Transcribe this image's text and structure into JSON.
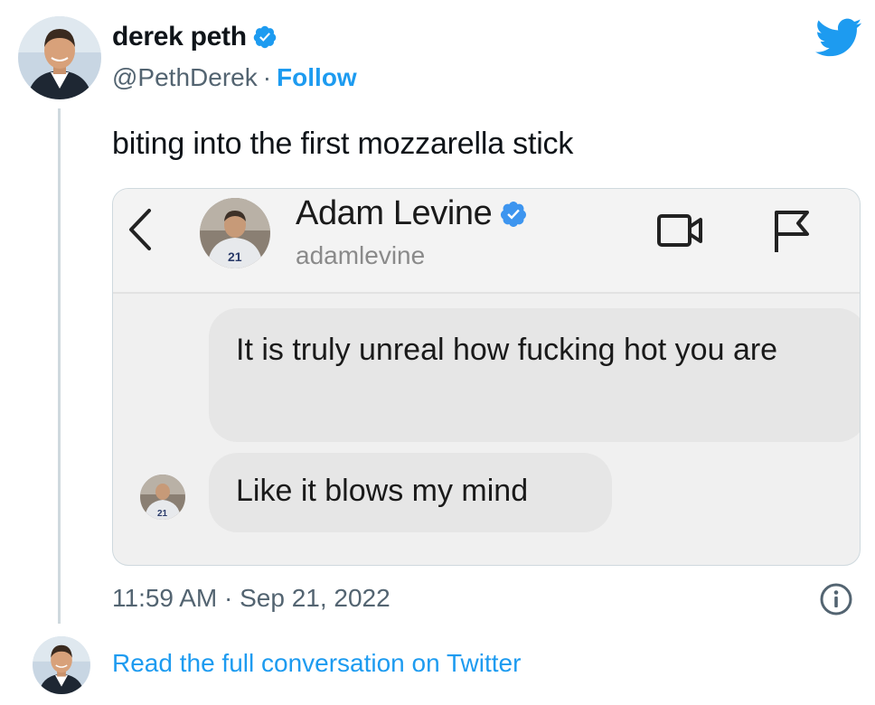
{
  "author": {
    "display_name": "derek peth",
    "handle": "@PethDerek",
    "separator": "·",
    "follow_label": "Follow",
    "avatar": "author-avatar"
  },
  "tweet": {
    "text": "biting into the first mozzarella stick",
    "timestamp": "11:59 AM · Sep 21, 2022"
  },
  "media": {
    "dm_header": {
      "name": "Adam Levine",
      "username": "adamlevine",
      "icons": [
        "back-chevron-icon",
        "video-call-icon",
        "flag-icon"
      ]
    },
    "messages": [
      {
        "text": "It is truly unreal how fucking hot you are"
      },
      {
        "text": "Like it blows my mind"
      }
    ]
  },
  "footer": {
    "read_more": "Read the full conversation on Twitter"
  },
  "colors": {
    "twitter_blue": "#1d9bf0",
    "secondary_text": "#536471",
    "border": "#cfd9de",
    "bubble": "#e6e6e6"
  }
}
